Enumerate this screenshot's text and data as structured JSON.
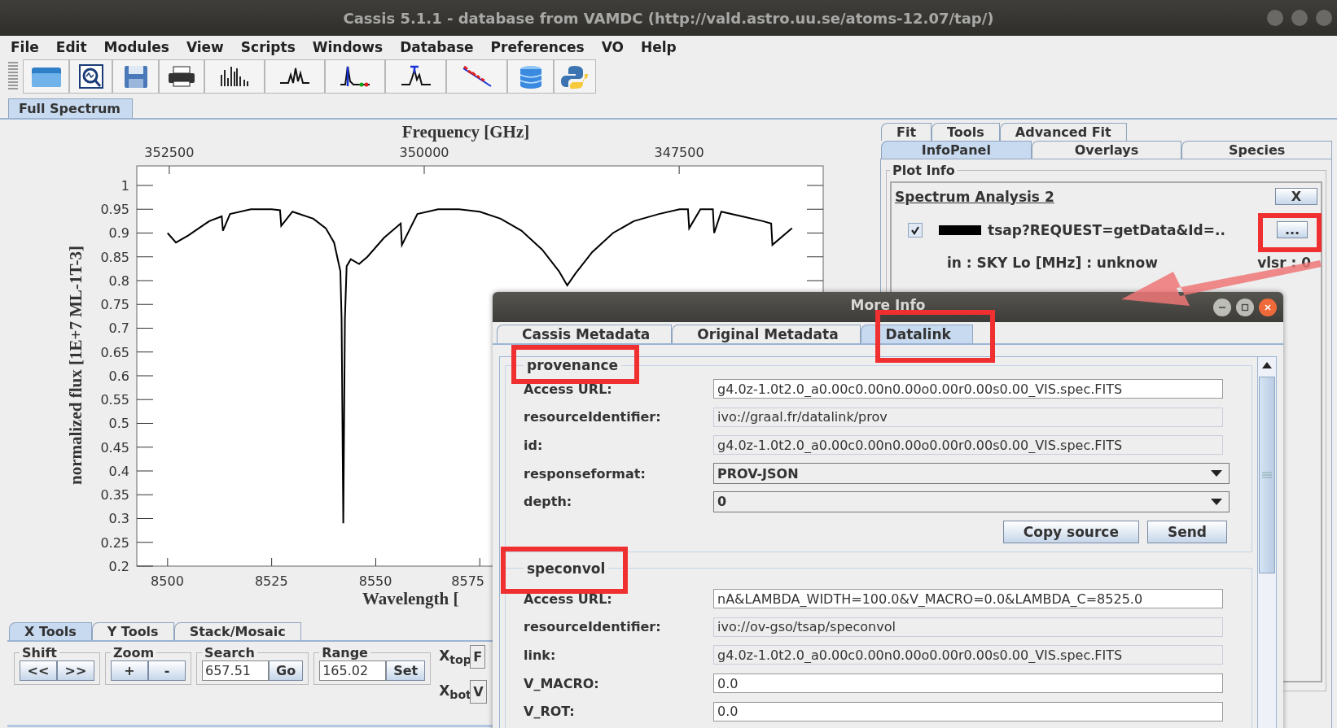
{
  "window": {
    "title": "Cassis 5.1.1 - database from VAMDC (http://vald.astro.uu.se/atoms-12.07/tap/)"
  },
  "menu": [
    "File",
    "Edit",
    "Modules",
    "View",
    "Scripts",
    "Windows",
    "Database",
    "Preferences",
    "VO",
    "Help"
  ],
  "toolbar": [
    {
      "kind": "folder"
    },
    {
      "kind": "zoom-doc"
    },
    {
      "kind": "save"
    },
    {
      "kind": "print"
    },
    {
      "kind": "bars"
    },
    {
      "kind": "peaks"
    },
    {
      "kind": "markers"
    },
    {
      "kind": "t-peak"
    },
    {
      "kind": "fit"
    },
    {
      "kind": "database"
    },
    {
      "kind": "python"
    }
  ],
  "view_tabs": [
    {
      "label": "Full Spectrum",
      "selected": true
    }
  ],
  "plot": {
    "top_axis": {
      "title": "Frequency [GHz]",
      "ticks": [
        "352500",
        "350000",
        "347500"
      ]
    },
    "chart_data": {
      "type": "line",
      "xlabel": "Wavelength [",
      "ylabel": "normalized flux [1E+7 ML-1T-3]",
      "x": [
        8500,
        8502,
        8505,
        8510,
        8513,
        8513.3,
        8515,
        8520,
        8525,
        8527,
        8527.3,
        8530,
        8535,
        8538,
        8540,
        8541.5,
        8541.8,
        8542.2,
        8542.6,
        8543,
        8544,
        8546,
        8548,
        8552,
        8556,
        8556.3,
        8560,
        8565,
        8570,
        8575,
        8580,
        8585,
        8590,
        8594,
        8596,
        8598,
        8602,
        8607,
        8612,
        8618,
        8623,
        8625,
        8625.3,
        8628,
        8631,
        8631.3,
        8633,
        8638,
        8643,
        8645,
        8645.3,
        8650
      ],
      "series": [
        {
          "color": "#000000",
          "values": [
            0.9,
            0.88,
            0.895,
            0.925,
            0.935,
            0.905,
            0.94,
            0.95,
            0.95,
            0.948,
            0.915,
            0.945,
            0.93,
            0.91,
            0.88,
            0.82,
            0.72,
            0.29,
            0.72,
            0.83,
            0.845,
            0.835,
            0.85,
            0.89,
            0.92,
            0.875,
            0.94,
            0.95,
            0.95,
            0.945,
            0.93,
            0.905,
            0.865,
            0.82,
            0.79,
            0.815,
            0.86,
            0.9,
            0.925,
            0.94,
            0.95,
            0.95,
            0.91,
            0.95,
            0.95,
            0.9,
            0.945,
            0.935,
            0.925,
            0.92,
            0.875,
            0.91
          ]
        }
      ],
      "xlim": [
        8492.6,
        8657.5
      ],
      "ylim": [
        0.2,
        1.041
      ],
      "xticks": [
        8500,
        8525,
        8550,
        8575
      ],
      "yticks": [
        1,
        0.95,
        0.9,
        0.85,
        0.8,
        0.75,
        0.7,
        0.65,
        0.6,
        0.55,
        0.5,
        0.45,
        0.4,
        0.35,
        0.3,
        0.25,
        0.2
      ]
    }
  },
  "side_panel": {
    "tabs_row_1": [
      {
        "label": "Fit",
        "selected": false
      },
      {
        "label": "Tools",
        "selected": false
      },
      {
        "label": "Advanced Fit",
        "selected": false
      }
    ],
    "tabs_row_2": [
      {
        "label": "InfoPanel",
        "selected": true
      },
      {
        "label": "Overlays",
        "selected": false
      },
      {
        "label": "Species",
        "selected": false
      }
    ],
    "group_title": "Plot Info",
    "analysis_title": "Spectrum Analysis 2",
    "close_label": "X",
    "entry": {
      "checked": true,
      "color": "#000000",
      "name": "tsap?REQUEST=getData&Id=..",
      "more_label": "...",
      "info": "in : SKY Lo [MHz] : unknow",
      "vlsr": "vlsr : 0"
    }
  },
  "tool_tabs": [
    {
      "label": "X Tools",
      "selected": true
    },
    {
      "label": "Y Tools",
      "selected": false
    },
    {
      "label": "Stack/Mosaic",
      "selected": false
    }
  ],
  "tool_groups": [
    {
      "title": "Shift",
      "kind": "buttons",
      "buttons": [
        "<<",
        ">>"
      ]
    },
    {
      "title": "Zoom",
      "kind": "buttons",
      "buttons": [
        "+",
        "-"
      ]
    },
    {
      "title": "Search",
      "kind": "input",
      "value": "657.51",
      "button": "Go"
    },
    {
      "title": "Range",
      "kind": "input",
      "value": "165.02",
      "button": "Set"
    }
  ],
  "axis_selectors": [
    {
      "label": "X$_{top}$",
      "value": "F"
    },
    {
      "label": "X$_{bot}$",
      "value": "V"
    }
  ],
  "dialog": {
    "title": "More Info",
    "tabs": [
      {
        "label": "Cassis Metadata",
        "selected": false
      },
      {
        "label": "Original Metadata",
        "selected": false
      },
      {
        "label": "Datalink",
        "selected": true
      }
    ],
    "sections": [
      {
        "title": "provenance",
        "fields": [
          {
            "label": "Access URL:",
            "kind": "text",
            "editable": true,
            "value": "g4.0z-1.0t2.0_a0.00c0.00n0.00o0.00r0.00s0.00_VIS.spec.FITS"
          },
          {
            "label": "resourceIdentifier:",
            "kind": "text",
            "editable": false,
            "value": "ivo://graal.fr/datalink/prov"
          },
          {
            "label": "id:",
            "kind": "text",
            "editable": false,
            "value": "g4.0z-1.0t2.0_a0.00c0.00n0.00o0.00r0.00s0.00_VIS.spec.FITS"
          },
          {
            "label": "responseformat:",
            "kind": "select",
            "value": "PROV-JSON"
          },
          {
            "label": "depth:",
            "kind": "select",
            "value": "0"
          }
        ],
        "buttons": [
          "Copy source",
          "Send"
        ]
      },
      {
        "title": "speconvol",
        "fields": [
          {
            "label": "Access URL:",
            "kind": "text",
            "editable": true,
            "value": "nA&LAMBDA_WIDTH=100.0&V_MACRO=0.0&LAMBDA_C=8525.0"
          },
          {
            "label": "resourceIdentifier:",
            "kind": "text",
            "editable": false,
            "value": "ivo://ov-gso/tsap/speconvol"
          },
          {
            "label": "link:",
            "kind": "text",
            "editable": false,
            "value": "g4.0z-1.0t2.0_a0.00c0.00n0.00o0.00r0.00s0.00_VIS.spec.FITS"
          },
          {
            "label": "V_MACRO:",
            "kind": "text",
            "editable": true,
            "value": "0.0"
          },
          {
            "label": "V_ROT:",
            "kind": "text",
            "editable": true,
            "value": "0.0"
          }
        ]
      }
    ]
  }
}
